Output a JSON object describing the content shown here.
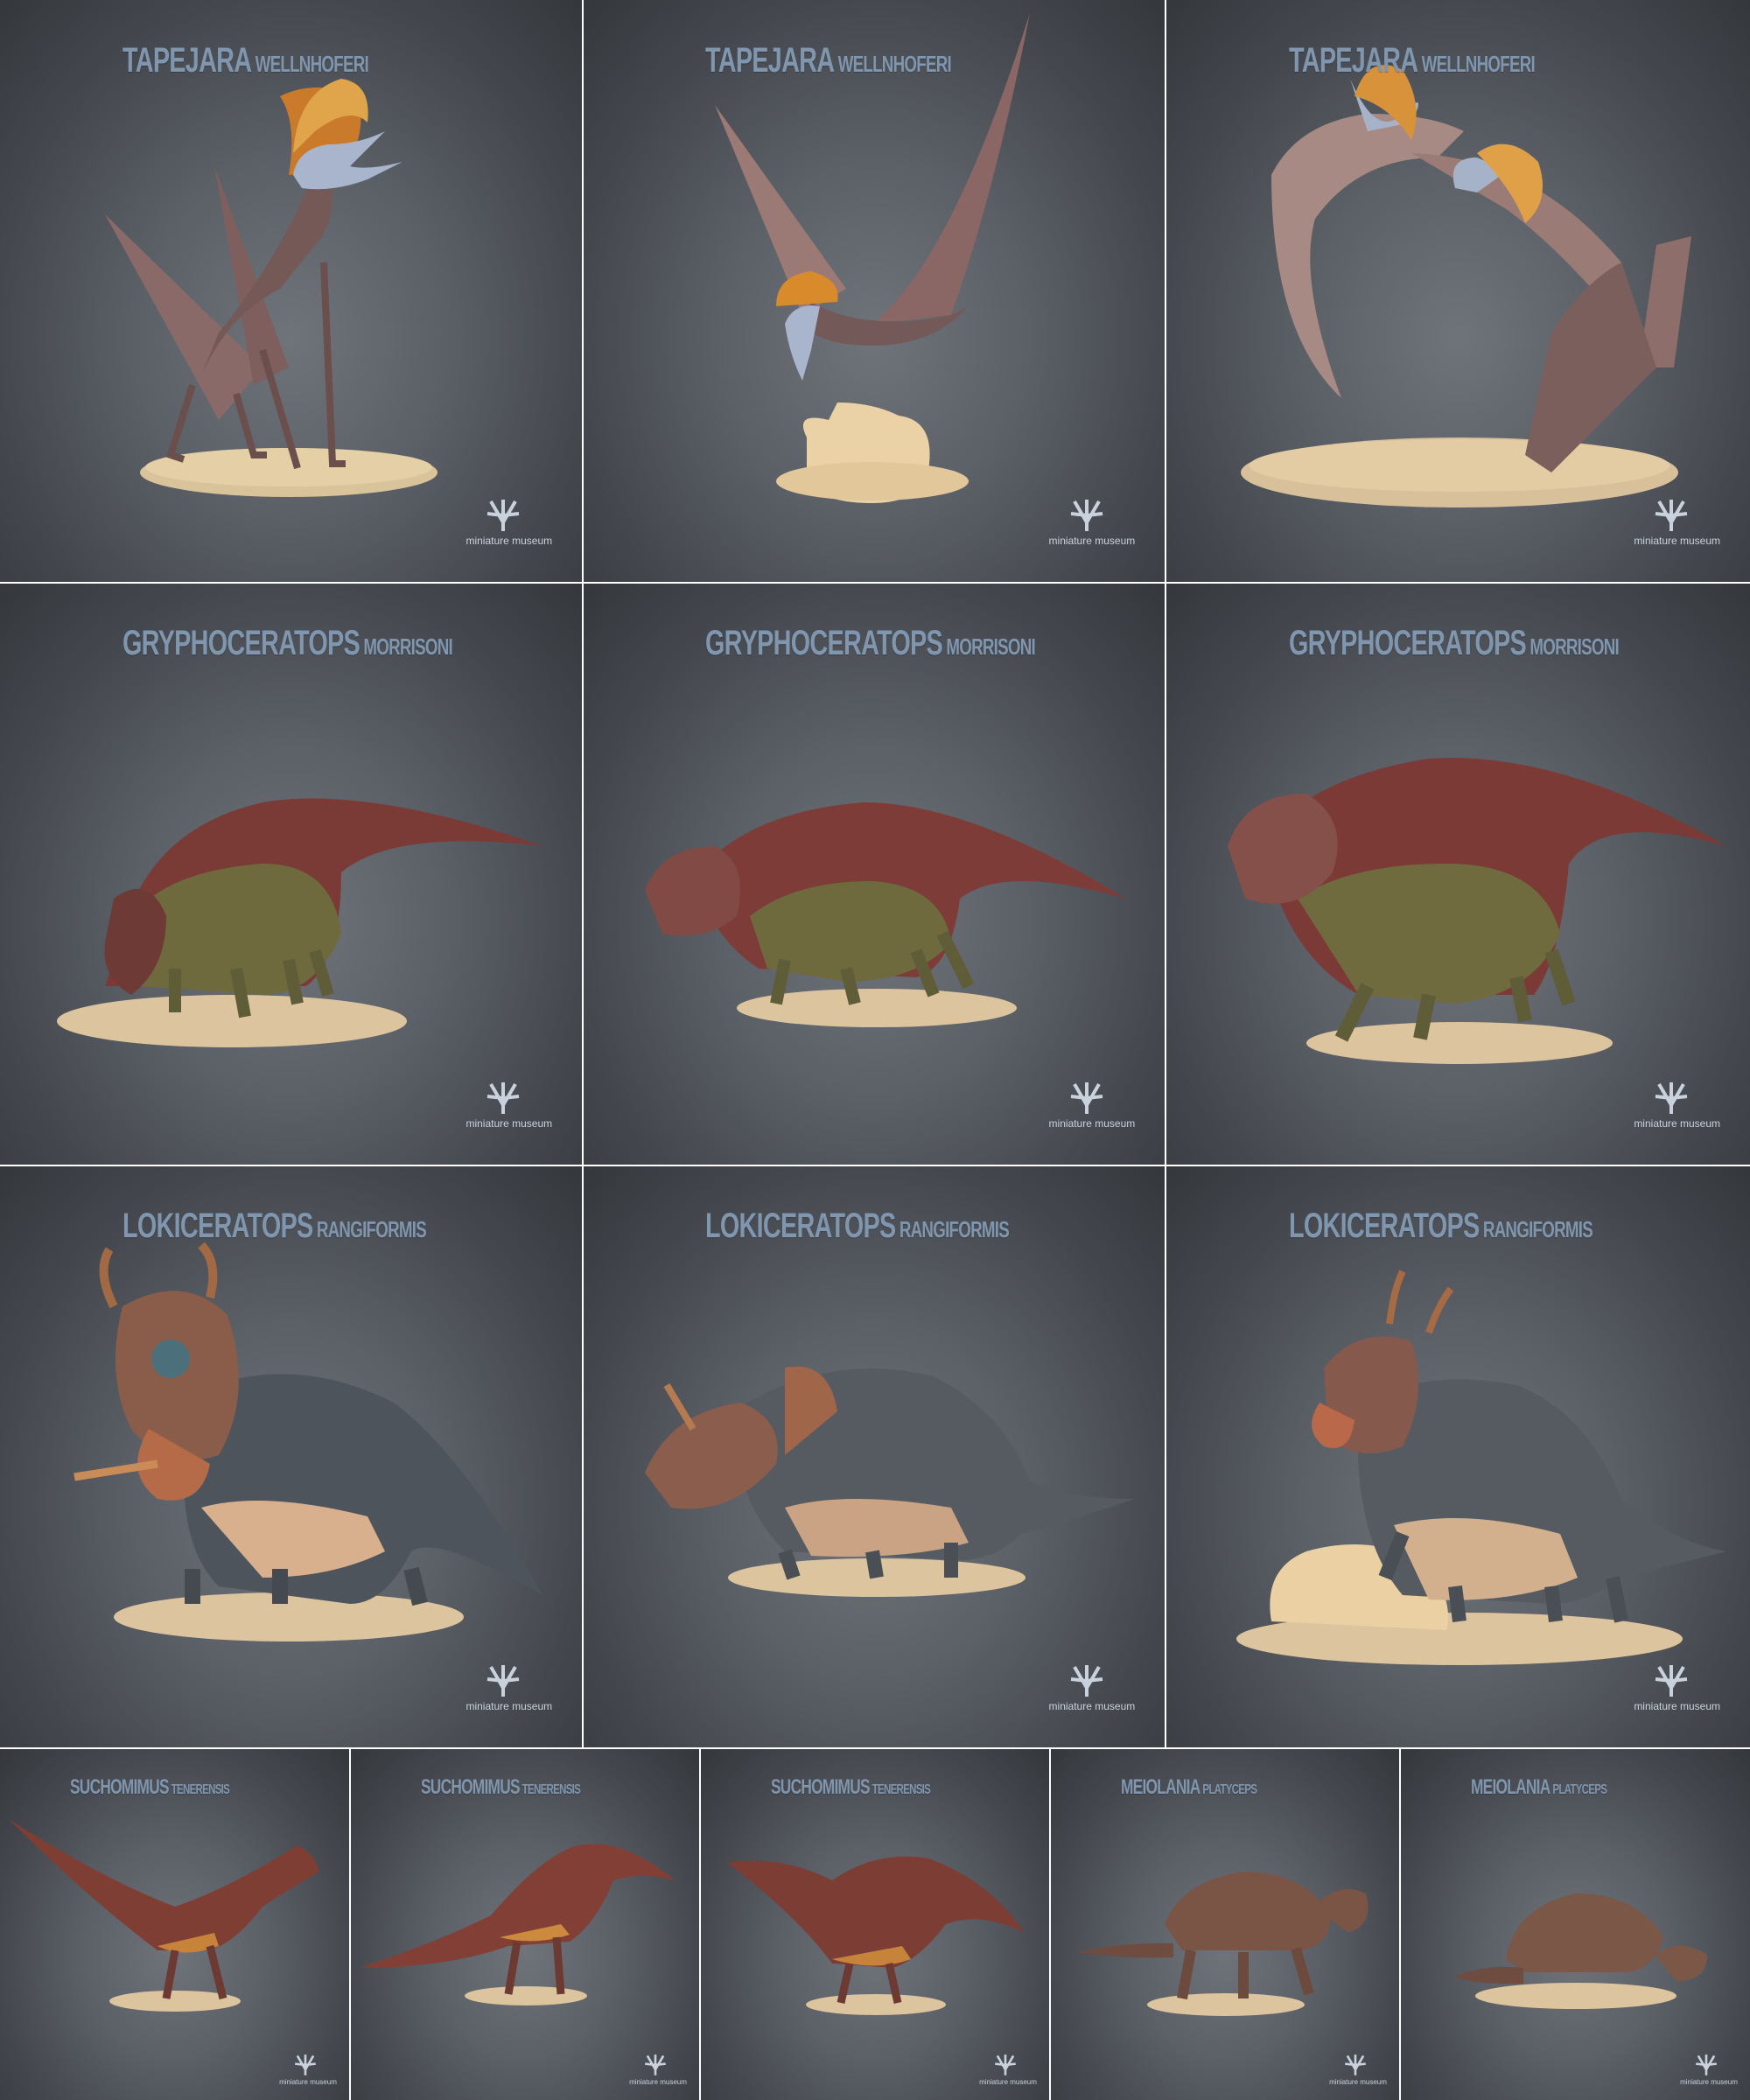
{
  "brand": "miniature museum",
  "tiles": [
    {
      "genus": "TAPEJARA",
      "species": "WELLNHOFERI",
      "subject": "pterosaur-standing"
    },
    {
      "genus": "TAPEJARA",
      "species": "WELLNHOFERI",
      "subject": "pterosaur-flying"
    },
    {
      "genus": "TAPEJARA",
      "species": "WELLNHOFERI",
      "subject": "pterosaur-pair"
    },
    {
      "genus": "GRYPHOCERATOPS",
      "species": "MORRISONI",
      "subject": "ceratopsian-grazing"
    },
    {
      "genus": "GRYPHOCERATOPS",
      "species": "MORRISONI",
      "subject": "ceratopsian-walking"
    },
    {
      "genus": "GRYPHOCERATOPS",
      "species": "MORRISONI",
      "subject": "ceratopsian-standing"
    },
    {
      "genus": "LOKICERATOPS",
      "species": "RANGIFORMIS",
      "subject": "ceratopsian-front"
    },
    {
      "genus": "LOKICERATOPS",
      "species": "RANGIFORMIS",
      "subject": "ceratopsian-side"
    },
    {
      "genus": "LOKICERATOPS",
      "species": "RANGIFORMIS",
      "subject": "ceratopsian-rock"
    },
    {
      "genus": "SUCHOMIMUS",
      "species": "TENERENSIS",
      "subject": "theropod-1"
    },
    {
      "genus": "SUCHOMIMUS",
      "species": "TENERENSIS",
      "subject": "theropod-2"
    },
    {
      "genus": "SUCHOMIMUS",
      "species": "TENERENSIS",
      "subject": "theropod-3"
    },
    {
      "genus": "MEIOLANIA",
      "species": "PLATYCEPS",
      "subject": "turtle-walking"
    },
    {
      "genus": "MEIOLANIA",
      "species": "PLATYCEPS",
      "subject": "turtle-resting"
    }
  ]
}
